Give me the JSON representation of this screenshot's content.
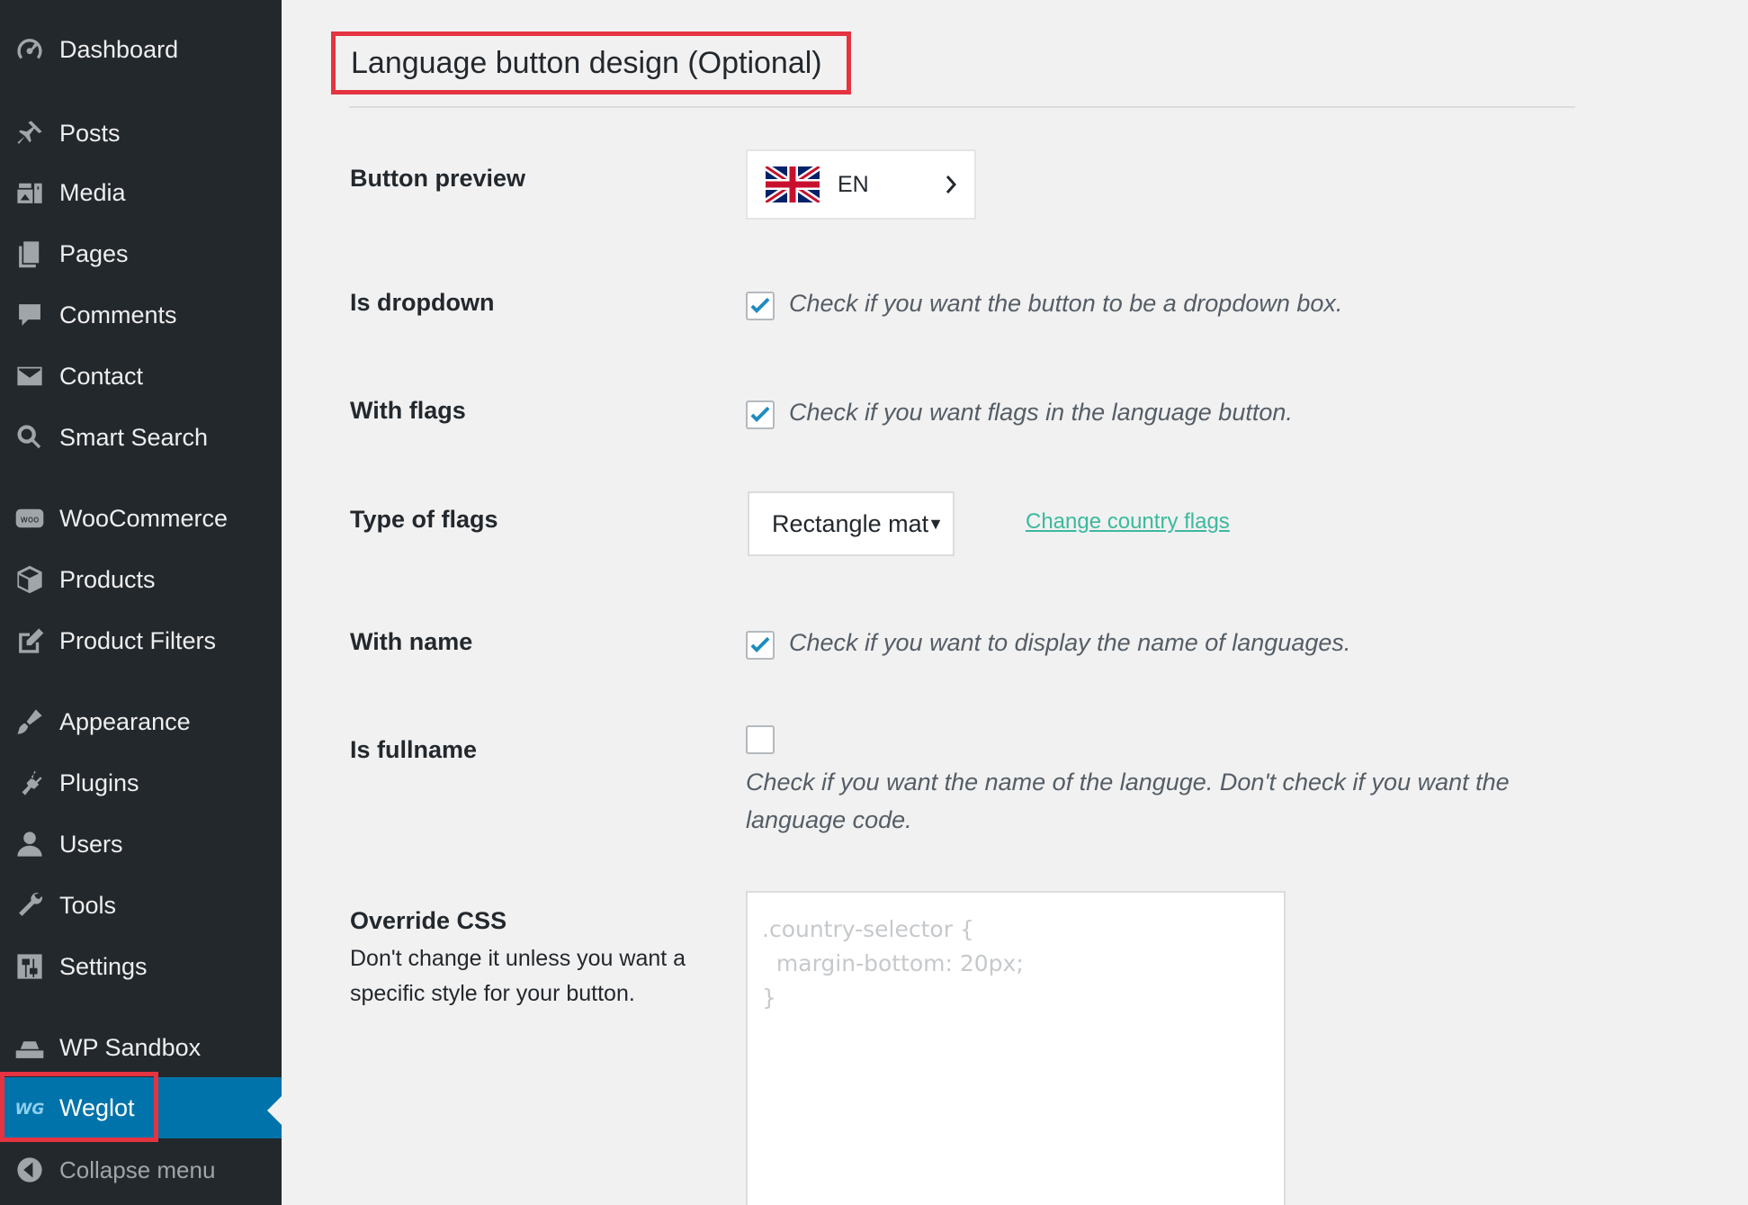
{
  "sidebar": {
    "items": [
      {
        "label": "Dashboard",
        "icon": "dashboard-icon"
      },
      {
        "label": "Posts",
        "icon": "pin-icon"
      },
      {
        "label": "Media",
        "icon": "media-icon"
      },
      {
        "label": "Pages",
        "icon": "pages-icon"
      },
      {
        "label": "Comments",
        "icon": "comment-icon"
      },
      {
        "label": "Contact",
        "icon": "mail-icon"
      },
      {
        "label": "Smart Search",
        "icon": "search-icon"
      },
      {
        "label": "WooCommerce",
        "icon": "woo-icon"
      },
      {
        "label": "Products",
        "icon": "box-icon"
      },
      {
        "label": "Product Filters",
        "icon": "edit-icon"
      },
      {
        "label": "Appearance",
        "icon": "brush-icon"
      },
      {
        "label": "Plugins",
        "icon": "plug-icon"
      },
      {
        "label": "Users",
        "icon": "user-icon"
      },
      {
        "label": "Tools",
        "icon": "wrench-icon"
      },
      {
        "label": "Settings",
        "icon": "settings-icon"
      },
      {
        "label": "WP Sandbox",
        "icon": "sandbox-icon"
      },
      {
        "label": "Weglot",
        "icon": "weglot-icon",
        "active": true
      }
    ],
    "collapse_label": "Collapse menu"
  },
  "main": {
    "section_title": "Language button design (Optional)",
    "button_preview": {
      "label": "Button preview",
      "code": "EN"
    },
    "is_dropdown": {
      "label": "Is dropdown",
      "checked": true,
      "description": "Check if you want the button to be a dropdown box."
    },
    "with_flags": {
      "label": "With flags",
      "checked": true,
      "description": "Check if you want flags in the language button."
    },
    "type_of_flags": {
      "label": "Type of flags",
      "selected": "Rectangle mat",
      "link": "Change country flags"
    },
    "with_name": {
      "label": "With name",
      "checked": true,
      "description": "Check if you want to display the name of languages."
    },
    "is_fullname": {
      "label": "Is fullname",
      "checked": false,
      "description": "Check if you want the name of the languge. Don't check if you want the language code."
    },
    "override_css": {
      "label": "Override CSS",
      "description": "Don't change it unless you want a specific style for your button.",
      "placeholder": ".country-selector {\n  margin-bottom: 20px;\n}"
    }
  },
  "colors": {
    "sidebar_bg": "#23282d",
    "active_bg": "#0073aa",
    "highlight": "#e53341",
    "link": "#3bb99d",
    "checkmark": "#1e8cbe"
  }
}
